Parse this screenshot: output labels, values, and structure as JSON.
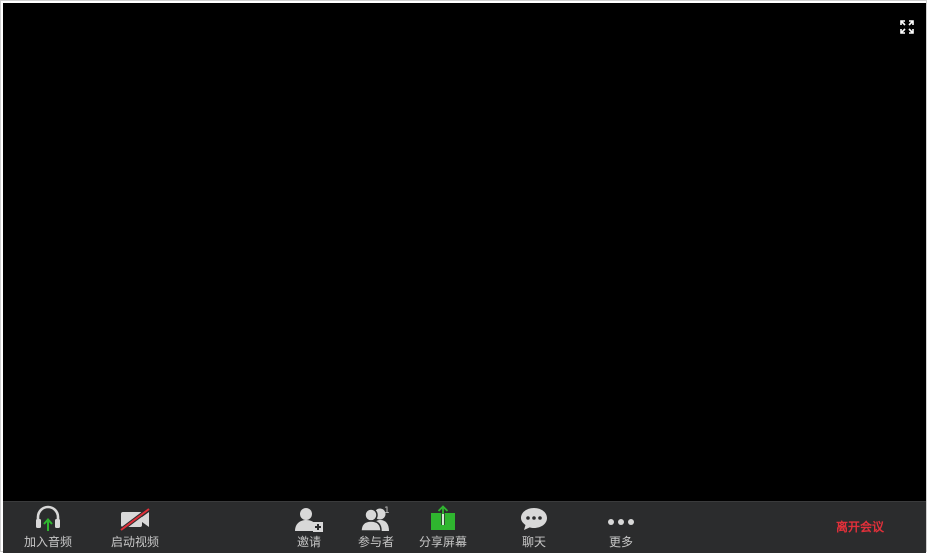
{
  "toolbar": {
    "join_audio": "加入音频",
    "start_video": "启动视频",
    "invite": "邀请",
    "participants": "参与者",
    "participants_count": "1",
    "share_screen": "分享屏幕",
    "chat": "聊天",
    "more": "更多",
    "leave": "离开会议"
  },
  "colors": {
    "video_bg": "#000000",
    "toolbar_bg": "#2b2c2d",
    "share_green": "#2fb62f",
    "audio_arrow_green": "#2fb62f",
    "leave_red": "#e0303a",
    "video_slash_red": "#e0303a",
    "icon_gray": "#d8d8d8"
  },
  "icons": [
    "fullscreen-icon",
    "headphones-icon",
    "video-off-icon",
    "add-user-icon",
    "participants-icon",
    "share-screen-icon",
    "chat-icon",
    "more-icon"
  ]
}
